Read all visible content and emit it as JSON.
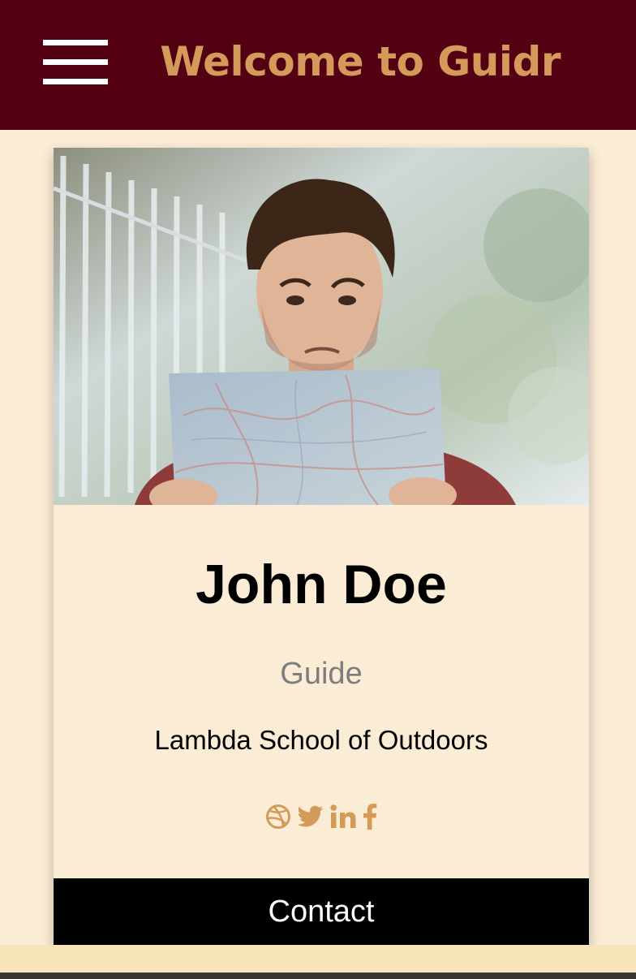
{
  "header": {
    "title": "Welcome to Guidr",
    "menu_icon": "hamburger-menu-icon"
  },
  "profile": {
    "photo_description_icon": "profile-photo",
    "name": "John Doe",
    "role": "Guide",
    "school": "Lambda School of Outdoors",
    "social_icons": [
      "dribbble-icon",
      "twitter-icon",
      "linkedin-icon",
      "facebook-icon"
    ],
    "contact_label": "Contact"
  },
  "colors": {
    "header_bg": "#520012",
    "accent": "#d49a5a",
    "page_bg": "#fbecd6",
    "button_bg": "#000000"
  }
}
